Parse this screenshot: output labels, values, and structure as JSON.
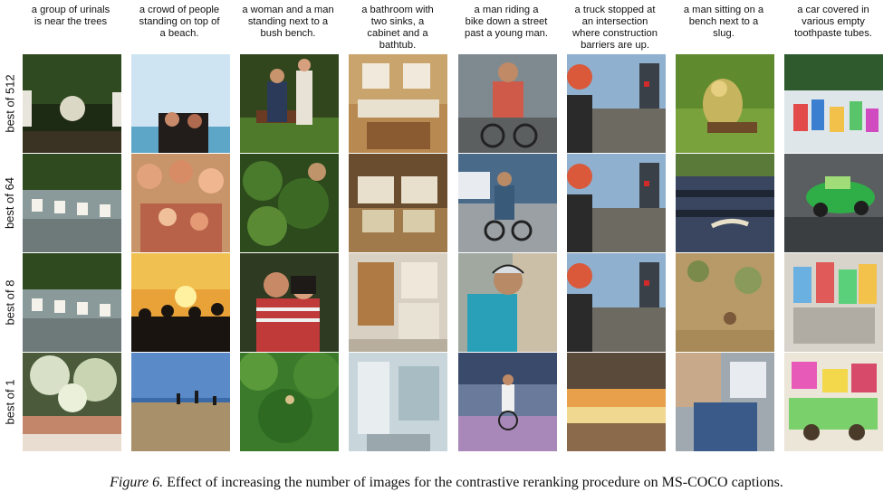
{
  "columns": [
    {
      "caption": "a group of urinals\nis near the trees"
    },
    {
      "caption": "a crowd of people\nstanding on top of\na beach."
    },
    {
      "caption": "a woman and a man\nstanding next to a\nbush bench."
    },
    {
      "caption": "a bathroom with\ntwo sinks, a\ncabinet and a\nbathtub."
    },
    {
      "caption": "a man riding a\nbike down a street\npast a young man."
    },
    {
      "caption": "a truck stopped at\nan intersection\nwhere construction\nbarriers are up."
    },
    {
      "caption": "a man sitting on a\nbench next to a\nslug."
    },
    {
      "caption": "a car covered in\nvarious empty\ntoothpaste tubes."
    }
  ],
  "rows": [
    {
      "label": "best of 512"
    },
    {
      "label": "best of 64"
    },
    {
      "label": "best of 8"
    },
    {
      "label": "best of 1"
    }
  ],
  "figure_caption": {
    "label": "Figure 6.",
    "text": " Effect of increasing the number of images for the contrastive reranking procedure on MS-COCO captions."
  }
}
